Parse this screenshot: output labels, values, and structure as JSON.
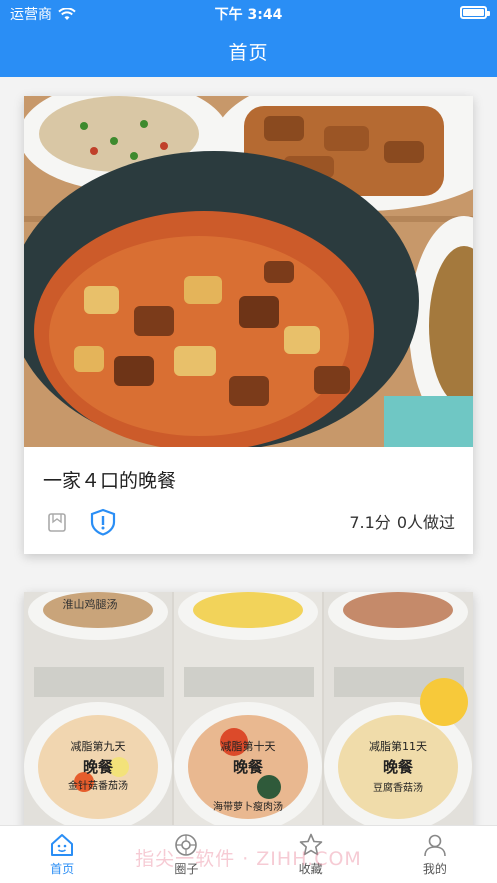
{
  "status_bar": {
    "carrier": "运营商",
    "time": "下午 3:44"
  },
  "nav": {
    "title": "首页"
  },
  "recipes": [
    {
      "title": "一家４口的晚餐",
      "score": "7.1分",
      "made_count": "0人做过"
    }
  ],
  "second_card": {
    "labels": [
      "淮山鸡腿汤",
      "减脂第九天",
      "晚餐",
      "金针菇番茄汤",
      "减脂第十天",
      "晚餐",
      "海带萝卜瘦肉汤",
      "减脂第11天",
      "晚餐",
      "豆腐香菇汤"
    ]
  },
  "tabbar": {
    "items": [
      {
        "label": "首页",
        "icon": "home-icon",
        "active": true
      },
      {
        "label": "圈子",
        "icon": "circle-icon",
        "active": false
      },
      {
        "label": "收藏",
        "icon": "star-icon",
        "active": false
      },
      {
        "label": "我的",
        "icon": "person-icon",
        "active": false
      }
    ]
  },
  "watermark": "指尖一软件 · ZIHH.COM",
  "colors": {
    "accent": "#2a8ef5",
    "background": "#f3f3f3"
  }
}
